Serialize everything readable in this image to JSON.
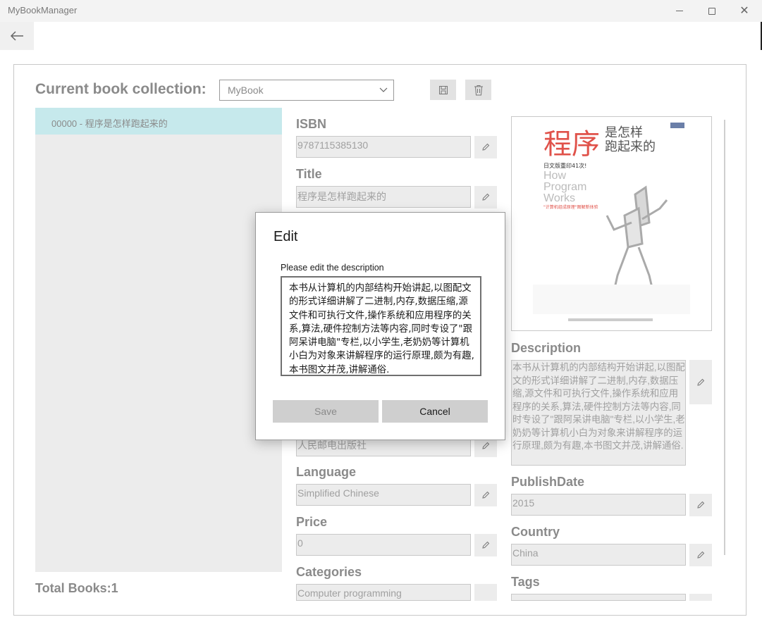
{
  "window": {
    "title": "MyBookManager"
  },
  "header": {
    "collection_label": "Current book collection:",
    "collection_value": "MyBook"
  },
  "book_list": {
    "items": [
      {
        "label": "00000 - 程序是怎样跑起来的"
      }
    ],
    "total_label": "Total Books:1"
  },
  "fields": {
    "isbn": {
      "label": "ISBN",
      "value": "9787115385130"
    },
    "title": {
      "label": "Title",
      "value": "程序是怎样跑起来的"
    },
    "publisher": {
      "value": "人民邮电出版社"
    },
    "language": {
      "label": "Language",
      "value": "Simplified Chinese"
    },
    "price": {
      "label": "Price",
      "value": "0"
    },
    "categories": {
      "label": "Categories",
      "value": "Computer programming"
    },
    "description": {
      "label": "Description",
      "value": "本书从计算机的内部结构开始讲起,以图配文的形式详细讲解了二进制,内存,数据压缩,源文件和可执行文件,操作系统和应用程序的关系,算法,硬件控制方法等内容,同时专设了\"跟阿呆讲电脑\"专栏,以小学生,老奶奶等计算机小白为对象来讲解程序的运行原理,颇为有趣,本书图文并茂,讲解通俗."
    },
    "publish_date": {
      "label": "PublishDate",
      "value": "2015"
    },
    "country": {
      "label": "Country",
      "value": "China"
    },
    "tags": {
      "label": "Tags"
    }
  },
  "cover": {
    "title_big": "程序",
    "title_rest_1": "是怎样",
    "title_rest_2": "跑起来的",
    "reprint": "日文版重印41次!",
    "english_1": "How",
    "english_2": "Program",
    "english_3": "Works",
    "subtitle": "\"计算机组成原理\"图解新体验"
  },
  "dialog": {
    "title": "Edit",
    "prompt": "Please edit the description",
    "text": "本书从计算机的内部结构开始讲起,以图配文的形式详细讲解了二进制,内存,数据压缩,源文件和可执行文件,操作系统和应用程序的关系,算法,硬件控制方法等内容,同时专设了\"跟阿呆讲电脑\"专栏,以小学生,老奶奶等计算机小白为对象来讲解程序的运行原理,颇为有趣,本书图文并茂,讲解通俗.",
    "save_label": "Save",
    "cancel_label": "Cancel"
  },
  "colors": {
    "accent_selected": "#c6e9ec",
    "field_bg": "#ececec",
    "cover_red": "#e0524a"
  },
  "icons": {
    "back": "back-arrow-icon",
    "save": "save-disk-icon",
    "delete": "trash-icon",
    "edit": "pencil-icon",
    "dropdown": "chevron-down-icon"
  }
}
